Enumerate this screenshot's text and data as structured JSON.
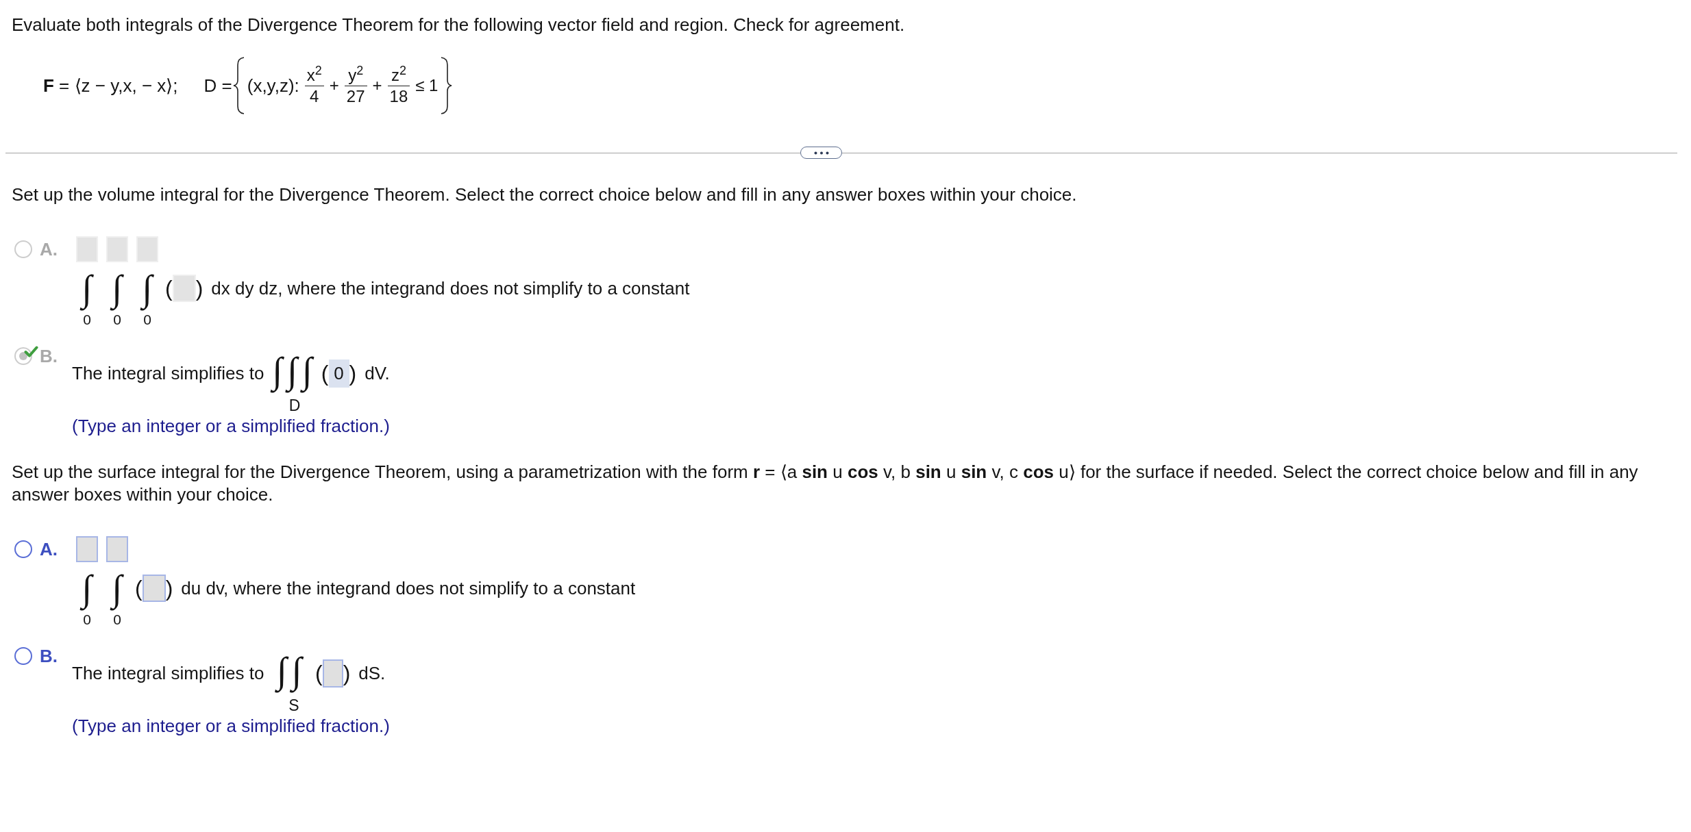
{
  "instructions": "Evaluate both integrals of the Divergence Theorem for the following vector field and region. Check for agreement.",
  "problem": {
    "field": "**F** = ⟨z − y,x, − x⟩;",
    "region": {
      "lhs": "D =",
      "variables": "(x,y,z):",
      "terms": [
        {
          "kind": "fraction",
          "numerator": "x$^{2}$",
          "denominator": "4"
        },
        {
          "kind": "operator",
          "text": "+"
        },
        {
          "kind": "fraction",
          "numerator": "y$^{2}$",
          "denominator": "27"
        },
        {
          "kind": "operator",
          "text": "+"
        },
        {
          "kind": "fraction",
          "numerator": "z$^{2}$",
          "denominator": "18"
        },
        {
          "kind": "relation",
          "text": "≤ 1"
        }
      ]
    }
  },
  "parts": [
    {
      "prompt": "Set up the volume integral for the Divergence Theorem. Select the correct choice below and fill in any answer boxes within your choice.",
      "disabled": true,
      "choices": [
        {
          "kind": "iterated",
          "letter": "A.",
          "selected": false,
          "correct": false,
          "integrals": [
            {
              "sign": "∫",
              "lower": "0"
            },
            {
              "sign": "∫",
              "lower": "0"
            },
            {
              "sign": "∫",
              "lower": "0"
            }
          ],
          "open": "(",
          "close": ")",
          "text": "dx dy dz, where the integrand does not simplify to a constant"
        },
        {
          "kind": "simplified",
          "letter": "B.",
          "selected": true,
          "correct": true,
          "lead": "The integral simplifies to",
          "signs": "∫∫∫",
          "domain": "D",
          "open": "(",
          "value": "0",
          "close": ")",
          "differential": "dV.",
          "hint": "(Type an integer or a simplified fraction.)"
        }
      ]
    },
    {
      "prompt": "Set up the surface integral for the Divergence Theorem, using a parametrization with the form **r** = ⟨a **sin** u **cos** v, b **sin** u **sin** v, c **cos** u⟩ for the surface if needed. Select the correct choice below and fill in any answer boxes within your choice.",
      "disabled": false,
      "choices": [
        {
          "kind": "iterated",
          "letter": "A.",
          "selected": false,
          "correct": false,
          "integrals": [
            {
              "sign": "∫",
              "lower": "0"
            },
            {
              "sign": "∫",
              "lower": "0"
            }
          ],
          "open": "(",
          "close": ")",
          "text": "du dv, where the integrand does not simplify to a constant"
        },
        {
          "kind": "simplified",
          "letter": "B.",
          "selected": false,
          "correct": false,
          "lead": "The integral simplifies to",
          "signs": "∫∫",
          "domain": "S",
          "open": "(",
          "close": ")",
          "differential": "dS.",
          "hint": "(Type an integer or a simplified fraction.)"
        }
      ]
    }
  ]
}
